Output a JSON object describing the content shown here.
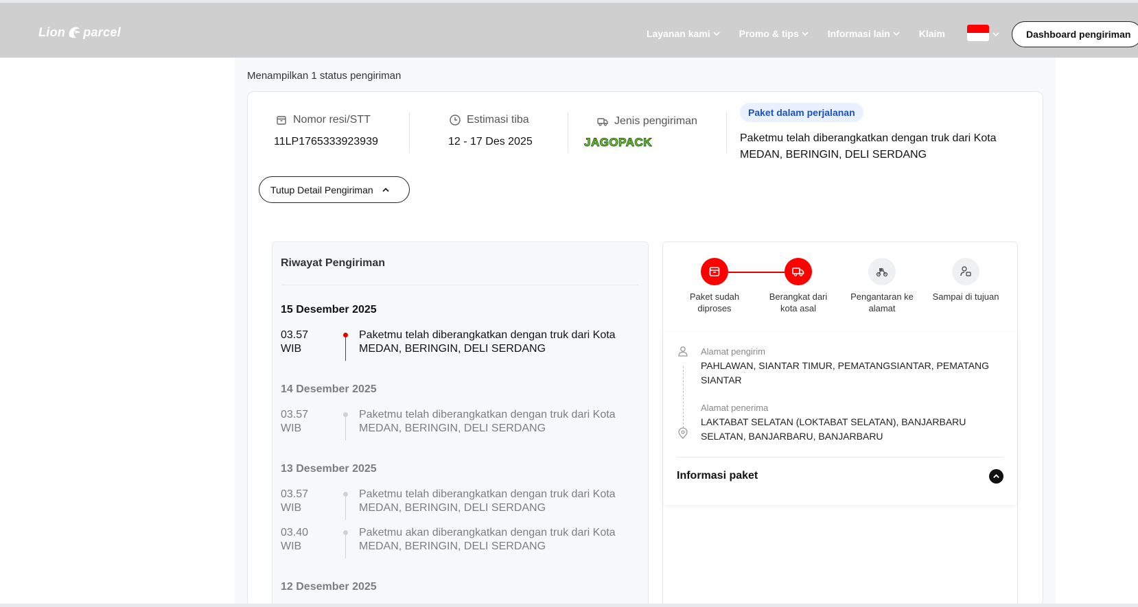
{
  "navbar": {
    "logo_left": "Lion",
    "logo_right": "parcel",
    "items": [
      {
        "label": "Layanan kami",
        "has_dropdown": true
      },
      {
        "label": "Promo & tips",
        "has_dropdown": true
      },
      {
        "label": "Informasi lain",
        "has_dropdown": true
      },
      {
        "label": "Klaim",
        "has_dropdown": false
      }
    ],
    "language_flag": "flag-indonesia-icon",
    "dashboard_button": "Dashboard pengiriman"
  },
  "results": {
    "count_text": "Menampilkan 1 status pengiriman"
  },
  "shipment": {
    "resi_label": "Nomor resi/STT",
    "resi_value": "11LP1765333923939",
    "eta_label": "Estimasi tiba",
    "eta_value": "12 - 17 Des 2025",
    "type_label": "Jenis pengiriman",
    "type_logo_text": "JAGOPACK",
    "status_badge": "Paket dalam perjalanan",
    "status_text": "Paketmu telah diberangkatkan dengan truk dari Kota MEDAN, BERINGIN, DELI SERDANG",
    "toggle_detail": "Tutup Detail Pengiriman"
  },
  "history": {
    "title": "Riwayat Pengiriman",
    "groups": [
      {
        "date": "15 Desember 2025",
        "entries": [
          {
            "time": "03.57",
            "tz": "WIB",
            "text": "Paketmu telah diberangkatkan dengan truk dari Kota MEDAN, BERINGIN, DELI SERDANG"
          }
        ]
      },
      {
        "date": "14 Desember 2025",
        "entries": [
          {
            "time": "03.57",
            "tz": "WIB",
            "text": "Paketmu telah diberangkatkan dengan truk dari Kota MEDAN, BERINGIN, DELI SERDANG"
          }
        ]
      },
      {
        "date": "13 Desember 2025",
        "entries": [
          {
            "time": "03.57",
            "tz": "WIB",
            "text": "Paketmu telah diberangkatkan dengan truk dari Kota MEDAN, BERINGIN, DELI SERDANG"
          },
          {
            "time": "03.40",
            "tz": "WIB",
            "text": "Paketmu akan diberangkatkan dengan truk dari Kota MEDAN, BERINGIN, DELI SERDANG"
          }
        ]
      },
      {
        "date": "12 Desember 2025",
        "entries": []
      }
    ]
  },
  "tracker": {
    "steps": [
      {
        "label": "Paket sudah diproses",
        "done": true,
        "icon": "package-icon"
      },
      {
        "label": "Berangkat dari kota asal",
        "done": true,
        "icon": "truck-icon"
      },
      {
        "label": "Pengantaran ke alamat",
        "done": false,
        "icon": "motorbike-icon"
      },
      {
        "label": "Sampai di tujuan",
        "done": false,
        "icon": "person-box-icon"
      }
    ],
    "accent_color": "#ff0000"
  },
  "address": {
    "sender_label": "Alamat pengirim",
    "sender_value": "PAHLAWAN, SIANTAR TIMUR, PEMATANGSIANTAR, PEMATANG SIANTAR",
    "receiver_label": "Alamat penerima",
    "receiver_value": "LAKTABAT SELATAN (LOKTABAT SELATAN), BANJARBARU SELATAN, BANJARBARU, BANJARBARU",
    "package_info_label": "Informasi paket"
  }
}
